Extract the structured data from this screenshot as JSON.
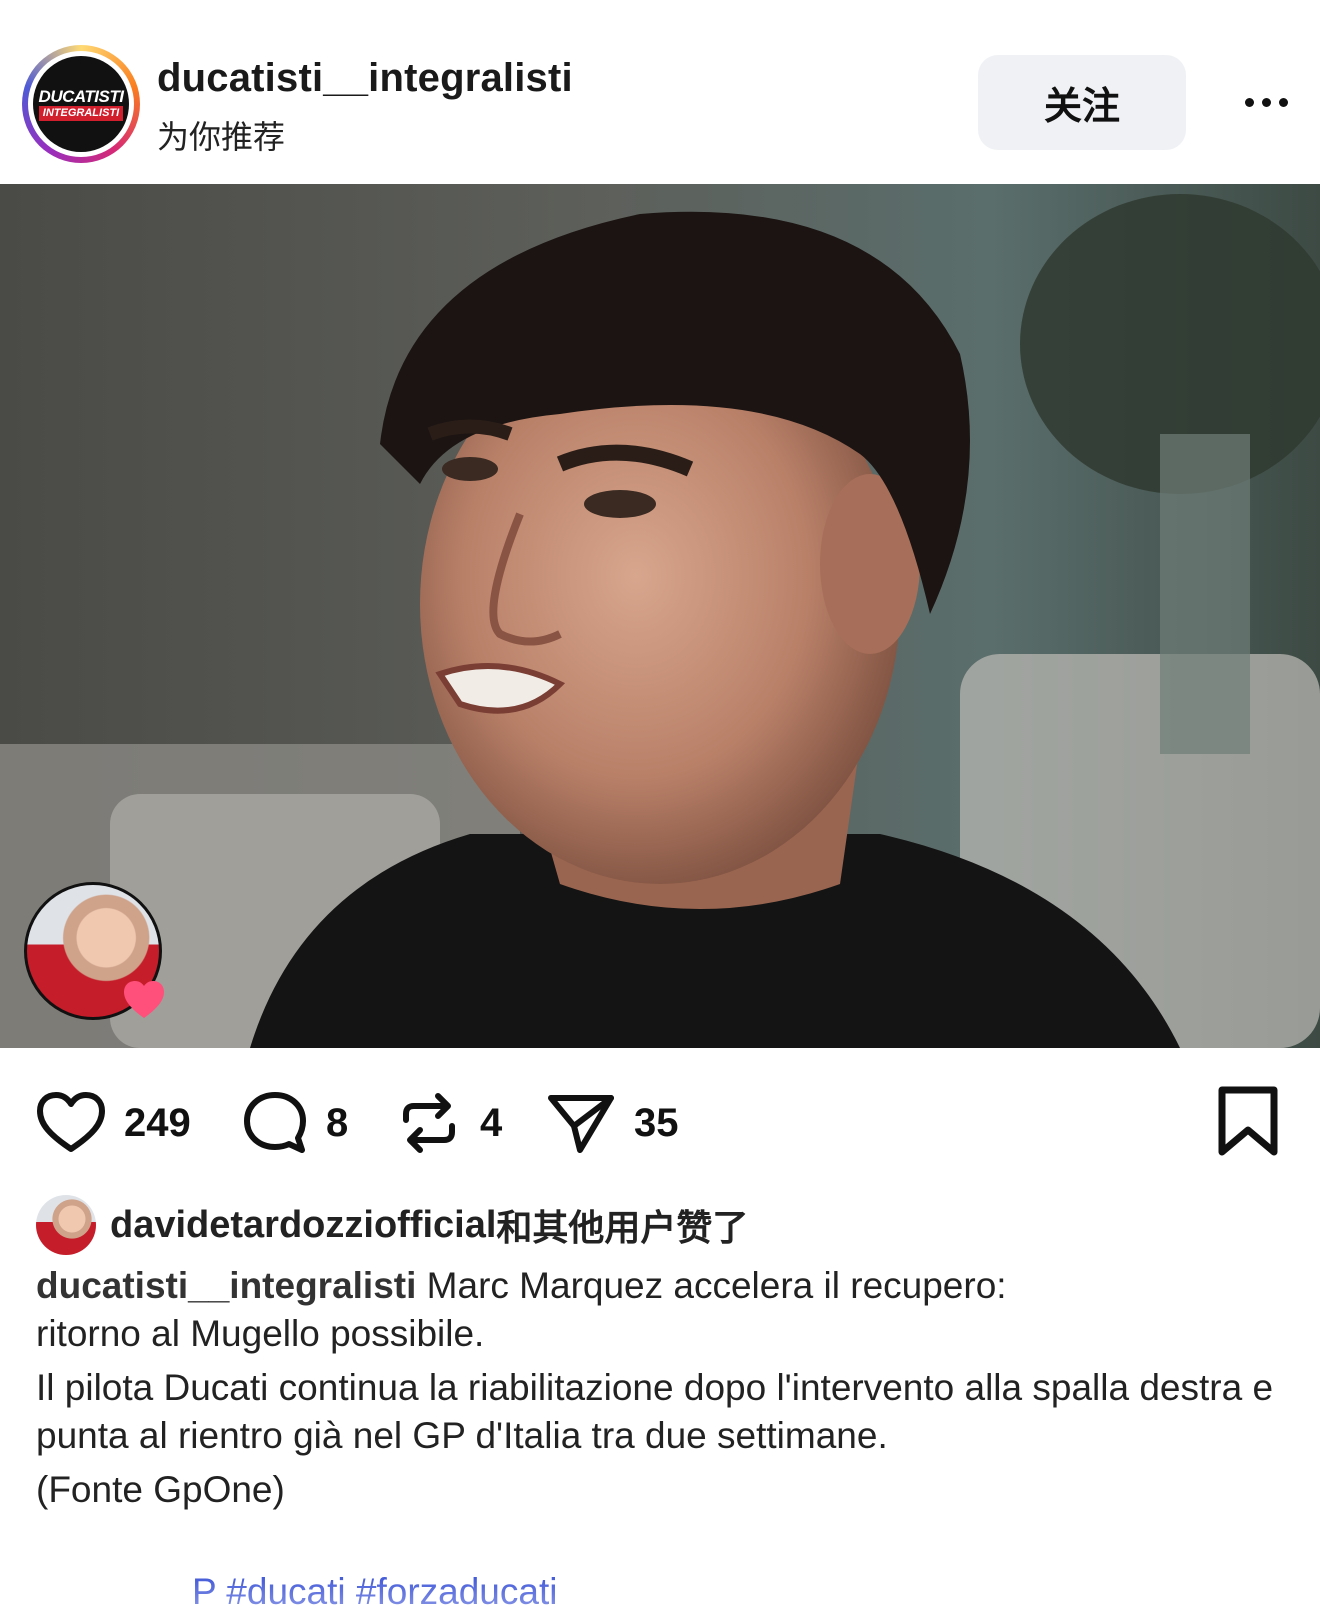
{
  "header": {
    "username": "ducatisti__integralisti",
    "subtitle": "为你推荐",
    "follow_label": "关注",
    "avatar_logo_top": "DUCATISTI",
    "avatar_logo_bottom": "INTEGRALISTI",
    "more_icon": "more-horizontal-icon"
  },
  "media": {
    "description_icon": "video-frame",
    "liker_badge_icon": "heart-icon"
  },
  "actions": {
    "like_count": "249",
    "comment_count": "8",
    "repost_count": "4",
    "share_count": "35"
  },
  "likes": {
    "user": "davidetardozziofficial",
    "rest": "和其他用户赞了"
  },
  "caption": {
    "user": "ducatisti__integralisti",
    "line1": "Marc Marquez accelera il recupero:",
    "line2": "ritorno al Mugello possibile.",
    "paragraph2": "Il pilota Ducati continua la riabilitazione dopo l'intervento alla spalla destra e punta al rientro già nel GP d'Italia tra due settimane.",
    "source": "(Fonte GpOne)",
    "hashtags": "P #ducati #forzaducati"
  },
  "colors": {
    "hashtag": "#3a52d6",
    "follow_bg": "#eff1f4",
    "heart_badge": "#ff3b6b"
  }
}
